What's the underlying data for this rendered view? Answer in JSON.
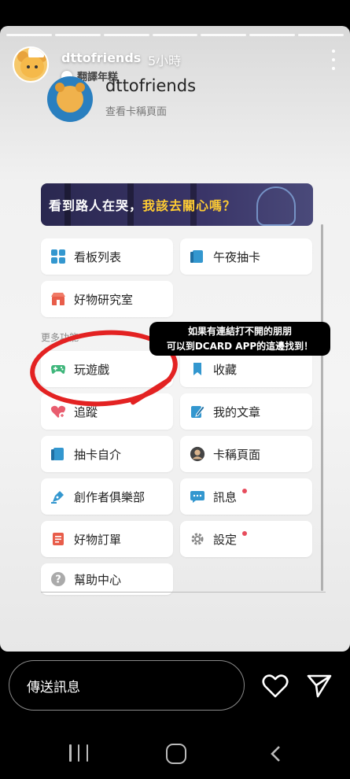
{
  "story": {
    "poster_name": "dttofriends",
    "post_time": "5小時",
    "translate_label": "翻譯年糕",
    "progress_segments": 7
  },
  "profile": {
    "name": "dttofriends",
    "subtitle": "查看卡稱頁面"
  },
  "banner": {
    "text_prefix": "看到路人在哭，",
    "text_highlight": "我該去關心嗎？"
  },
  "menu": {
    "section_label": "更多功能",
    "tiles": [
      {
        "label": "看板列表",
        "icon": "grid-icon",
        "color": "#3397cf"
      },
      {
        "label": "午夜抽卡",
        "icon": "card-icon",
        "color": "#3397cf"
      },
      {
        "label": "好物研究室",
        "icon": "shop-icon",
        "color": "#e85d4a"
      },
      {
        "label": "玩遊戲",
        "icon": "gamepad-icon",
        "color": "#3fb67b"
      },
      {
        "label": "收藏",
        "icon": "bookmark-icon",
        "color": "#3397cf"
      },
      {
        "label": "追蹤",
        "icon": "heart-follow-icon",
        "color": "#e85d6f"
      },
      {
        "label": "我的文章",
        "icon": "pencil-doc-icon",
        "color": "#3397cf"
      },
      {
        "label": "抽卡自介",
        "icon": "card-icon",
        "color": "#3397cf"
      },
      {
        "label": "卡稱頁面",
        "icon": "person-icon",
        "color": "#555555"
      },
      {
        "label": "創作者俱樂部",
        "icon": "pen-nib-icon",
        "color": "#3397cf"
      },
      {
        "label": "訊息",
        "icon": "chat-icon",
        "color": "#3397cf"
      },
      {
        "label": "好物訂單",
        "icon": "order-icon",
        "color": "#e85d4a"
      },
      {
        "label": "設定",
        "icon": "gear-icon",
        "color": "#888888"
      },
      {
        "label": "幫助中心",
        "icon": "help-icon",
        "color": "#aaaaaa"
      }
    ]
  },
  "callout": {
    "line1": "如果有連結打不開的朋朋",
    "line2": "可以到DCARD APP的這邊找到！"
  },
  "reply": {
    "placeholder": "傳送訊息"
  },
  "colors": {
    "annotation_red": "#e32222",
    "badge_red": "#e74c5c"
  }
}
